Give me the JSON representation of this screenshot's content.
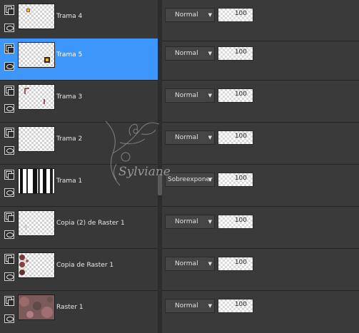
{
  "layers": [
    {
      "name": "Trama 4",
      "blend": "Normal",
      "opacity": "100",
      "opacity_fraction": 1.0,
      "selected": false
    },
    {
      "name": "Trama 5",
      "blend": "Normal",
      "opacity": "100",
      "opacity_fraction": 1.0,
      "selected": true
    },
    {
      "name": "Trama 3",
      "blend": "Normal",
      "opacity": "100",
      "opacity_fraction": 1.0,
      "selected": false
    },
    {
      "name": "Trama 2",
      "blend": "Normal",
      "opacity": "100",
      "opacity_fraction": 1.0,
      "selected": false
    },
    {
      "name": "Trama 1",
      "blend": "Sobreexponer",
      "opacity": "100",
      "opacity_fraction": 1.0,
      "selected": false
    },
    {
      "name": "Copia (2) de Raster 1",
      "blend": "Normal",
      "opacity": "100",
      "opacity_fraction": 1.0,
      "selected": false
    },
    {
      "name": "Copia de Raster 1",
      "blend": "Normal",
      "opacity": "100",
      "opacity_fraction": 1.0,
      "selected": false
    },
    {
      "name": "Raster 1",
      "blend": "Normal",
      "opacity": "100",
      "opacity_fraction": 1.0,
      "selected": false
    }
  ],
  "watermark": {
    "text": "Sylviane"
  },
  "icons": {
    "group": "layer-group-icon",
    "visibility": "eye-icon",
    "dropdown": "chevron-down-icon"
  },
  "colors": {
    "selection": "#3d97fb",
    "panel": "#383838",
    "control": "#454545"
  }
}
